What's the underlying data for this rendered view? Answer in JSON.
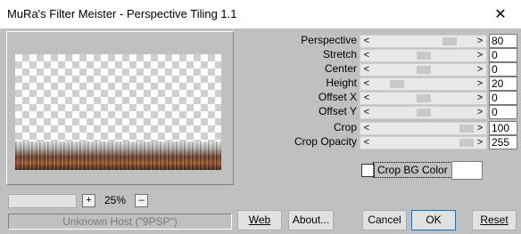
{
  "window": {
    "title": "MuRa's Filter Meister - Perspective Tiling 1.1",
    "close_icon": "close-icon"
  },
  "preview": {
    "zoom_value": "25%",
    "zoom_in_label": "+",
    "zoom_out_label": "–",
    "status_text": "Unknown Host (\"9PSP\")"
  },
  "params": [
    {
      "label": "Perspective",
      "value": "80",
      "level": 0.8
    },
    {
      "label": "Stretch",
      "value": "0",
      "level": 0.5
    },
    {
      "label": "Center",
      "value": "0",
      "level": 0.5
    },
    {
      "label": "Height",
      "value": "20",
      "level": 0.2
    },
    {
      "label": "Offset X",
      "value": "0",
      "level": 0.5
    },
    {
      "label": "Offset Y",
      "value": "0",
      "level": 0.5
    },
    {
      "label": "Crop",
      "value": "100",
      "level": 1.0
    },
    {
      "label": "Crop Opacity",
      "value": "255",
      "level": 1.0
    }
  ],
  "crop_bg": {
    "label": "Crop BG Color",
    "checked": false,
    "color": "#ffffff"
  },
  "buttons": {
    "web": "Web",
    "about": "About...",
    "cancel": "Cancel",
    "ok": "OK",
    "reset": "Reset"
  }
}
